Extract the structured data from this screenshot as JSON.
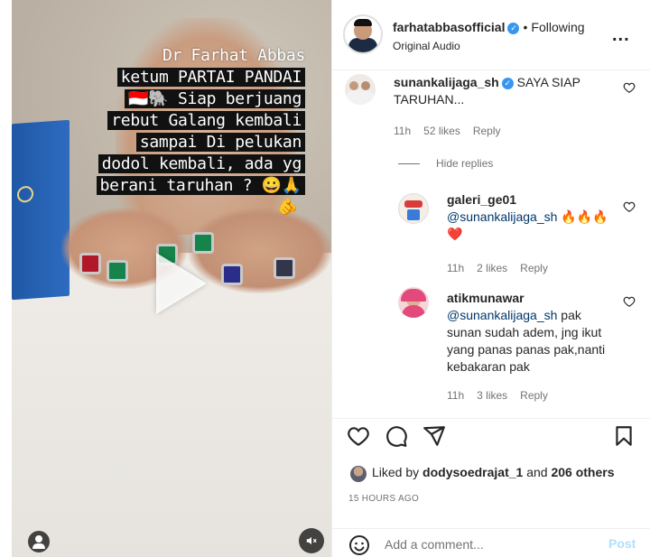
{
  "video": {
    "caption_lines": [
      "Dr Farhat Abbas",
      "ketum PARTAI PANDAI",
      "🇮🇩🐘  Siap berjuang",
      "rebut Galang kembali",
      "sampai  Di pelukan",
      "dodol kembali, ada yg",
      "berani taruhan ? 😀🙏"
    ],
    "extra_emoji": "🫵"
  },
  "header": {
    "username": "farhatabbasofficial",
    "separator": "•",
    "follow_status": "Following",
    "audio": "Original Audio",
    "more": "..."
  },
  "comments": [
    {
      "username": "sunankalijaga_sh",
      "text": "SAYA SIAP TARUHAN...",
      "time": "11h",
      "likes": "52 likes",
      "reply": "Reply"
    }
  ],
  "hide_replies": "Hide replies",
  "replies": [
    {
      "username": "galeri_ge01",
      "mention": "@sunankalijaga_sh",
      "text": "🔥🔥🔥 ❤️",
      "time": "11h",
      "likes": "2 likes",
      "reply": "Reply"
    },
    {
      "username": "atikmunawar",
      "mention": "@sunankalijaga_sh",
      "text": "pak sunan sudah adem, jng ikut yang panas panas pak,nanti kebakaran pak",
      "time": "11h",
      "likes": "3 likes",
      "reply": "Reply"
    }
  ],
  "likes_summary": {
    "prefix": "Liked by ",
    "user": "dodysoedrajat_1",
    "middle": " and ",
    "others": "206 others"
  },
  "timestamp": "15 HOURS AGO",
  "comment_box": {
    "placeholder": "Add a comment...",
    "post": "Post"
  },
  "colors": {
    "verified": "#3797f0",
    "post_disabled": "#b2dffc",
    "meta_gray": "#737373"
  },
  "icons": [
    "heart-icon",
    "comment-icon",
    "share-icon",
    "bookmark-icon",
    "emoji-icon",
    "play-icon",
    "mute-icon",
    "tagged-user-icon",
    "more-icon"
  ]
}
